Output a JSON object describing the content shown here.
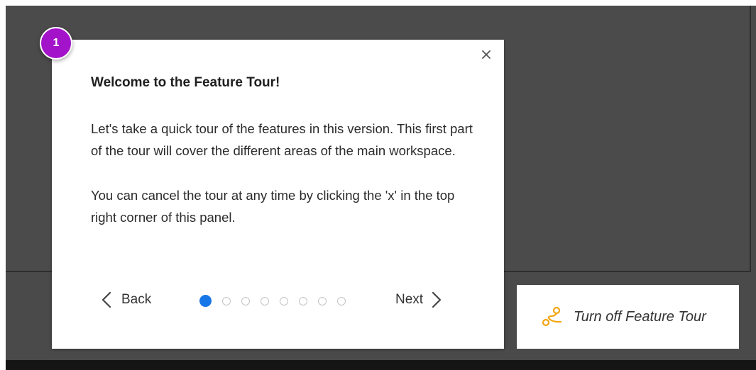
{
  "tour": {
    "step_number": "1",
    "title": "Welcome to the Feature Tour!",
    "paragraph_1": "Let's take a quick tour of the features in this version. This first part of the tour will cover the different areas of the main workspace.",
    "paragraph_2": "You can cancel the tour at any time by clicking the 'x' in the top right corner of this panel.",
    "back_label": "Back",
    "next_label": "Next",
    "current_step": 1,
    "total_steps": 8,
    "close_icon": "close-icon",
    "accent_color": "#1877e8",
    "badge_color": "#a313c9"
  },
  "toggle": {
    "label": "Turn off Feature Tour",
    "icon": "route-icon",
    "icon_color": "#f2a614"
  }
}
